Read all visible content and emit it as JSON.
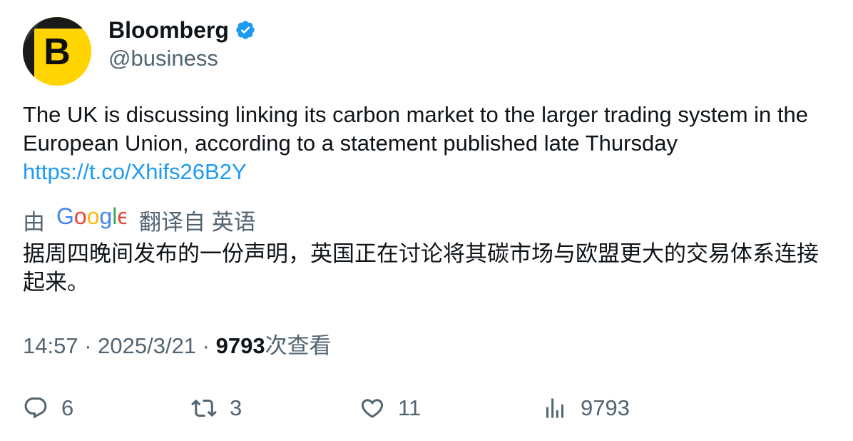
{
  "author": {
    "display_name": "Bloomberg",
    "handle": "@business",
    "avatar_letter": "B",
    "verified": true
  },
  "tweet": {
    "text": "The UK is discussing linking its carbon market to the larger trading system in the European Union, according to a statement published late Thursday",
    "link": "https://t.co/Xhifs26B2Y"
  },
  "translation": {
    "prefix": "由",
    "provider": "Google",
    "suffix": "翻译自 英语",
    "text": "据周四晚间发布的一份声明，英国正在讨论将其碳市场与欧盟更大的交易体系连接起来。"
  },
  "meta": {
    "time": "14:57",
    "separator": " · ",
    "date": "2025/3/21",
    "views_count": "9793",
    "views_label": "次查看"
  },
  "actions": {
    "replies": "6",
    "retweets": "3",
    "likes": "11",
    "views": "9793"
  },
  "colors": {
    "brand_yellow": "#ffd400",
    "verified_blue": "#1d9bf0",
    "link_blue": "#1d9bf0",
    "secondary_text": "#536471",
    "primary_text": "#0f1419"
  },
  "icons": {
    "reply": "reply-bubble-icon",
    "retweet": "retweet-arrows-icon",
    "like": "heart-icon",
    "views": "bar-chart-icon",
    "verified": "verified-badge-icon"
  }
}
